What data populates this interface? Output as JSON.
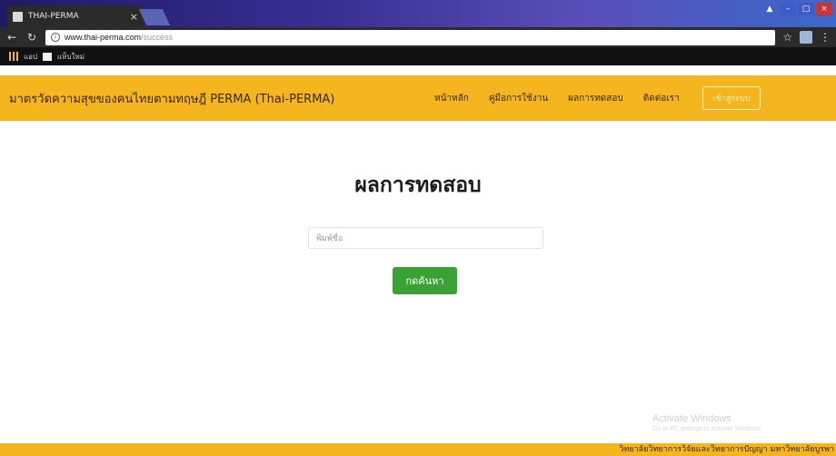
{
  "browser": {
    "tab_title": "THAI-PERMA",
    "tab_close": "×",
    "url_host": "www.thai-perma.com",
    "url_path": "/success",
    "bookmarks": [
      "แอป",
      "แท็บใหม่"
    ],
    "window_controls": {
      "user": "ผู้ใช้",
      "minimize": "–",
      "maximize": "□",
      "close": "×"
    }
  },
  "navbar": {
    "brand": "มาตรวัดความสุขของคนไทยตามทฤษฎี PERMA (Thai-PERMA)",
    "links": [
      "หน้าหลัก",
      "คู่มือการใช้งาน",
      "ผลการทดสอบ",
      "ติดต่อเรา"
    ],
    "login_label": "เข้าสู่ระบบ"
  },
  "main": {
    "title": "ผลการทดสอบ",
    "search_placeholder": "พิมพ์ชื่อ",
    "search_button": "กดค้นหา"
  },
  "watermark": {
    "title": "Activate Windows",
    "subtitle": "Go to PC settings to activate Windows."
  },
  "footer": {
    "text": "วิทยาลัยวิทยาการวิจัยและวิทยาการปัญญา มหาวิทยาลัยบูรพา"
  },
  "colors": {
    "navbar_bg": "#f4b51f",
    "button_green": "#3aa235",
    "footer_bg": "#f4b51f"
  }
}
